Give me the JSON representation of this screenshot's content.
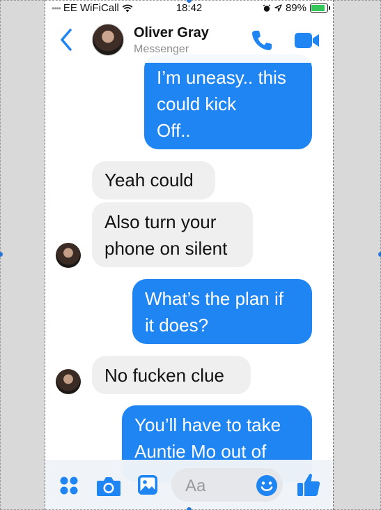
{
  "status_bar": {
    "carrier": "EE WiFiCall",
    "time": "18:42",
    "battery": "89%"
  },
  "header": {
    "contact_name": "Oliver Gray",
    "subtitle": "Messenger"
  },
  "messages": [
    {
      "from": "me",
      "text": "I’m uneasy.. this\ncould kick\nOff.."
    },
    {
      "from": "them",
      "text": "Yeah could"
    },
    {
      "from": "them",
      "text": "Also turn your\nphone on silent"
    },
    {
      "from": "me",
      "text": "What’s the plan if\nit does?"
    },
    {
      "from": "them",
      "text": "No fucken clue"
    },
    {
      "from": "me",
      "text": "You’ll have to take\nAuntie Mo out of"
    }
  ],
  "composer": {
    "placeholder": "Aa"
  },
  "colors": {
    "accent": "#1f85f3",
    "incoming_bubble": "#efefef",
    "battery": "#34c759"
  },
  "icons": [
    "wifi-icon",
    "alarm-icon",
    "location-icon",
    "battery-icon",
    "back-chevron-icon",
    "phone-icon",
    "video-camera-icon",
    "apps-grid-icon",
    "camera-icon",
    "photo-icon",
    "emoji-icon",
    "thumbs-up-icon"
  ]
}
